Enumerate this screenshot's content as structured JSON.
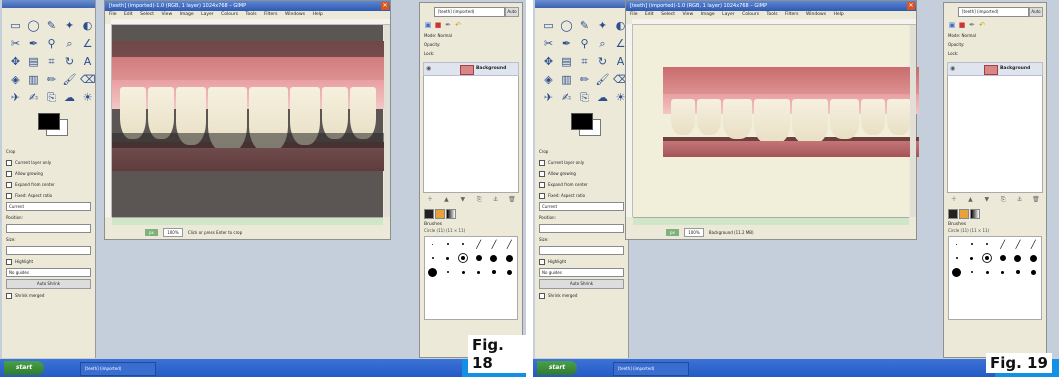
{
  "panels": [
    {
      "figure_label": "Fig. 18",
      "image_window": {
        "title": "[teeth] (imported)-1.0 (RGB, 1 layer) 1024x768 – GIMP",
        "menu": [
          "File",
          "Edit",
          "Select",
          "View",
          "Image",
          "Layer",
          "Colours",
          "Tools",
          "Filters",
          "Windows",
          "Help"
        ],
        "zoom": "100%",
        "unit": "px",
        "status": "Click or press Enter to crop"
      },
      "tool_options": {
        "heading": "Crop",
        "options": [
          "Current layer only",
          "Allow growing",
          "Expand from center",
          "Fixed: Aspect ratio"
        ],
        "ratio": "Current",
        "position_label": "Position:",
        "size_label": "Size:",
        "highlight": "Highlight",
        "guides": "No guides",
        "auto_shrink": "Auto Shrink",
        "shrink_merged": "Shrink merged"
      },
      "layers": {
        "image_select": "[teeth] (imported)",
        "auto_label": "Auto",
        "mode": "Mode: Normal",
        "opacity": "Opacity:",
        "lock": "Lock:",
        "layer_name": "Background",
        "brushes_title": "Brushes",
        "brush_sub": "Circle (11) (11 × 11)"
      },
      "taskbar": {
        "start": "start",
        "item": "[teeth] (imported)"
      }
    },
    {
      "figure_label": "Fig. 19",
      "image_window": {
        "title": "[teeth] (imported)-1.0 (RGB, 1 layer) 1024x768 – GIMP",
        "menu": [
          "File",
          "Edit",
          "Select",
          "View",
          "Image",
          "Layer",
          "Colours",
          "Tools",
          "Filters",
          "Windows",
          "Help"
        ],
        "zoom": "100%",
        "unit": "px",
        "status": "Background (11.2 MB)"
      },
      "tool_options": {
        "heading": "Crop",
        "options": [
          "Current layer only",
          "Allow growing",
          "Expand from center",
          "Fixed: Aspect ratio"
        ],
        "ratio": "Current",
        "position_label": "Position:",
        "size_label": "Size:",
        "highlight": "Highlight",
        "guides": "No guides",
        "auto_shrink": "Auto Shrink",
        "shrink_merged": "Shrink merged"
      },
      "layers": {
        "image_select": "[teeth] (imported)",
        "auto_label": "Auto",
        "mode": "Mode: Normal",
        "opacity": "Opacity:",
        "lock": "Lock:",
        "layer_name": "Background",
        "brushes_title": "Brushes",
        "brush_sub": "Circle (11) (11 × 11)"
      },
      "taskbar": {
        "start": "start",
        "item": "[teeth] (imported)"
      }
    }
  ]
}
